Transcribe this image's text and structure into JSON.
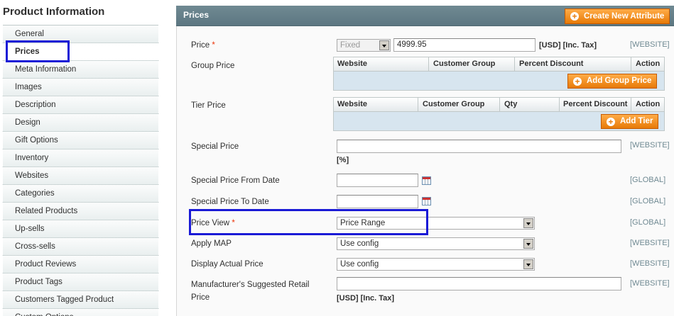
{
  "sidebar": {
    "title": "Product Information",
    "items": [
      {
        "label": "General"
      },
      {
        "label": "Prices"
      },
      {
        "label": "Meta Information"
      },
      {
        "label": "Images"
      },
      {
        "label": "Description"
      },
      {
        "label": "Design"
      },
      {
        "label": "Gift Options"
      },
      {
        "label": "Inventory"
      },
      {
        "label": "Websites"
      },
      {
        "label": "Categories"
      },
      {
        "label": "Related Products"
      },
      {
        "label": "Up-sells"
      },
      {
        "label": "Cross-sells"
      },
      {
        "label": "Product Reviews"
      },
      {
        "label": "Product Tags"
      },
      {
        "label": "Customers Tagged Product"
      },
      {
        "label": "Custom Options"
      }
    ],
    "active_index": 1
  },
  "panel": {
    "title": "Prices",
    "create_attribute_label": "Create New Attribute"
  },
  "fields": {
    "price": {
      "label": "Price",
      "required": "*",
      "type_value": "Fixed",
      "value": "4999.95",
      "note": "[USD] [Inc. Tax]",
      "scope": "[WEBSITE]"
    },
    "group_price": {
      "label": "Group Price",
      "columns": [
        "Website",
        "Customer Group",
        "Percent Discount",
        "Action"
      ],
      "add_label": "Add Group Price"
    },
    "tier_price": {
      "label": "Tier Price",
      "columns": [
        "Website",
        "Customer Group",
        "Qty",
        "Percent Discount",
        "Action"
      ],
      "add_label": "Add Tier"
    },
    "special_price": {
      "label": "Special Price",
      "value": "",
      "note": "[%]",
      "scope": "[WEBSITE]"
    },
    "special_from": {
      "label": "Special Price From Date",
      "value": "",
      "scope": "[GLOBAL]"
    },
    "special_to": {
      "label": "Special Price To Date",
      "value": "",
      "scope": "[GLOBAL]"
    },
    "price_view": {
      "label": "Price View",
      "required": "*",
      "value": "Price Range",
      "scope": "[GLOBAL]"
    },
    "apply_map": {
      "label": "Apply MAP",
      "value": "Use config",
      "scope": "[WEBSITE]"
    },
    "display_actual": {
      "label": "Display Actual Price",
      "value": "Use config",
      "scope": "[WEBSITE]"
    },
    "msrp": {
      "label_line1": "Manufacturer's Suggested Retail",
      "label_line2": "Price",
      "value": "",
      "note": "[USD] [Inc. Tax]",
      "scope": "[WEBSITE]"
    }
  },
  "colors": {
    "accent": "#eb5e00",
    "header": "#6f8992",
    "highlight": "#1a1ad6"
  }
}
